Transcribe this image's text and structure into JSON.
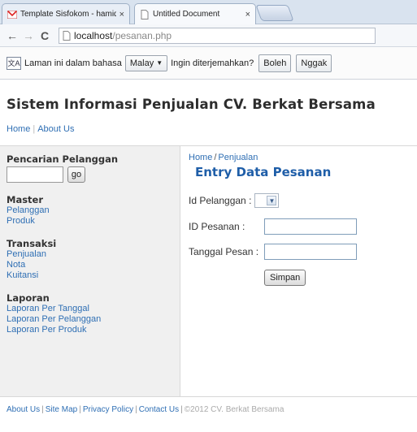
{
  "browser": {
    "tabs": [
      {
        "label": "Template Sisfokom - hamidal",
        "icon": "gmail-icon",
        "active": false
      },
      {
        "label": "Untitled Document",
        "icon": "document-icon",
        "active": true
      }
    ],
    "url_host": "localhost",
    "url_path": "/pesanan.php"
  },
  "translate_bar": {
    "text_before": "Laman ini dalam bahasa",
    "language": "Malay",
    "text_after": "Ingin diterjemahkan?",
    "yes_label": "Boleh",
    "no_label": "Nggak"
  },
  "site": {
    "title": "Sistem Informasi Penjualan CV. Berkat Bersama",
    "nav": [
      "Home",
      "About Us"
    ]
  },
  "sidebar": {
    "search_heading": "Pencarian Pelanggan",
    "search_value": "",
    "go_label": "go",
    "sections": [
      {
        "heading": "Master",
        "items": [
          "Pelanggan",
          "Produk"
        ]
      },
      {
        "heading": "Transaksi",
        "items": [
          "Penjualan",
          "Nota",
          "Kuitansi"
        ]
      },
      {
        "heading": "Laporan",
        "items": [
          "Laporan Per Tanggal",
          "Laporan Per Pelanggan",
          "Laporan Per Produk"
        ]
      }
    ]
  },
  "main": {
    "breadcrumb": [
      "Home",
      "Penjualan"
    ],
    "breadcrumb_sep": "/",
    "title": "Entry Data Pesanan",
    "fields": [
      {
        "label": "Id Pelanggan :",
        "type": "select",
        "value": ""
      },
      {
        "label": "ID Pesanan :",
        "type": "text",
        "value": ""
      },
      {
        "label": "Tanggal Pesan :",
        "type": "text",
        "value": ""
      }
    ],
    "submit_label": "Simpan"
  },
  "footer": {
    "links": [
      "About Us",
      "Site Map",
      "Privacy Policy",
      "Contact Us"
    ],
    "copyright": "©2012 CV. Berkat Bersama"
  },
  "colors": {
    "link": "#2f6fb4",
    "title_blue": "#1f5ea8",
    "sidebar_bg": "#f0f0f0"
  }
}
